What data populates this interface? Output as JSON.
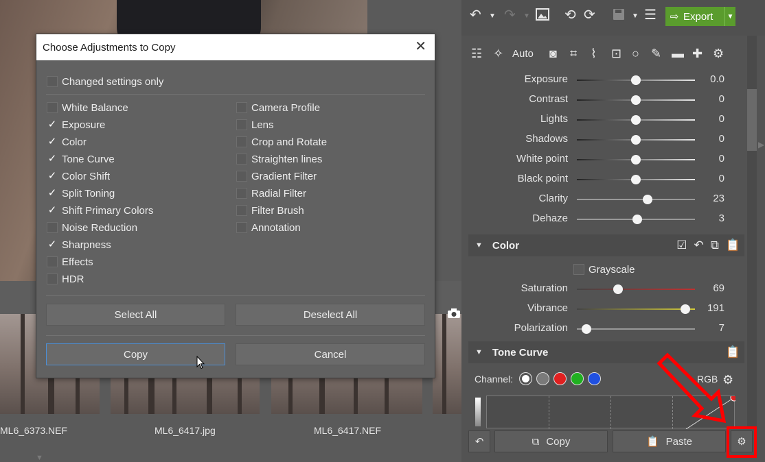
{
  "dialog": {
    "title": "Choose Adjustments to Copy",
    "changed_only": {
      "label": "Changed settings only",
      "checked": false
    },
    "left_items": [
      {
        "label": "White Balance",
        "checked": false
      },
      {
        "label": "Exposure",
        "checked": true
      },
      {
        "label": "Color",
        "checked": true
      },
      {
        "label": "Tone Curve",
        "checked": true
      },
      {
        "label": "Color Shift",
        "checked": true
      },
      {
        "label": "Split Toning",
        "checked": true
      },
      {
        "label": "Shift Primary Colors",
        "checked": true
      },
      {
        "label": "Noise Reduction",
        "checked": false
      },
      {
        "label": "Sharpness",
        "checked": true
      },
      {
        "label": "Effects",
        "checked": false
      },
      {
        "label": "HDR",
        "checked": false
      }
    ],
    "right_items": [
      {
        "label": "Camera Profile",
        "checked": false
      },
      {
        "label": "Lens",
        "checked": false
      },
      {
        "label": "Crop and Rotate",
        "checked": false
      },
      {
        "label": "Straighten lines",
        "checked": false
      },
      {
        "label": "Gradient Filter",
        "checked": false
      },
      {
        "label": "Radial Filter",
        "checked": false
      },
      {
        "label": "Filter Brush",
        "checked": false
      },
      {
        "label": "Annotation",
        "checked": false
      }
    ],
    "select_all": "Select All",
    "deselect_all": "Deselect All",
    "copy": "Copy",
    "cancel": "Cancel",
    "close_glyph": "✕"
  },
  "thumbnails": [
    "ML6_6373.NEF",
    "ML6_6417.jpg",
    "ML6_6417.NEF"
  ],
  "toolbar": {
    "export_label": "Export",
    "auto_label": "Auto"
  },
  "exposure_sliders": [
    {
      "label": "Exposure",
      "value": "0.0",
      "level": 0.5
    },
    {
      "label": "Contrast",
      "value": "0",
      "level": 0.5
    },
    {
      "label": "Lights",
      "value": "0",
      "level": 0.5
    },
    {
      "label": "Shadows",
      "value": "0",
      "level": 0.5
    },
    {
      "label": "White point",
      "value": "0",
      "level": 0.5
    },
    {
      "label": "Black point",
      "value": "0",
      "level": 0.5
    },
    {
      "label": "Clarity",
      "value": "23",
      "level": 0.6
    },
    {
      "label": "Dehaze",
      "value": "3",
      "level": 0.51
    }
  ],
  "color_section": {
    "title": "Color",
    "grayscale_label": "Grayscale",
    "sliders": [
      {
        "label": "Saturation",
        "value": "69",
        "level": 0.35
      },
      {
        "label": "Vibrance",
        "value": "191",
        "level": 0.92
      },
      {
        "label": "Polarization",
        "value": "7",
        "level": 0.08
      }
    ]
  },
  "tone_curve": {
    "title": "Tone Curve",
    "channel_label": "Channel:",
    "rgb_label": "RGB",
    "channel_colors": [
      "#ffffff",
      "#7a7a7a",
      "#e02020",
      "#20b020",
      "#2050e0"
    ]
  },
  "bottom": {
    "copy_label": "Copy",
    "paste_label": "Paste"
  },
  "colors": {
    "export_green": "#5a9c2d",
    "annotation_red": "#ff0000",
    "focus_blue": "#4b8fd8"
  }
}
